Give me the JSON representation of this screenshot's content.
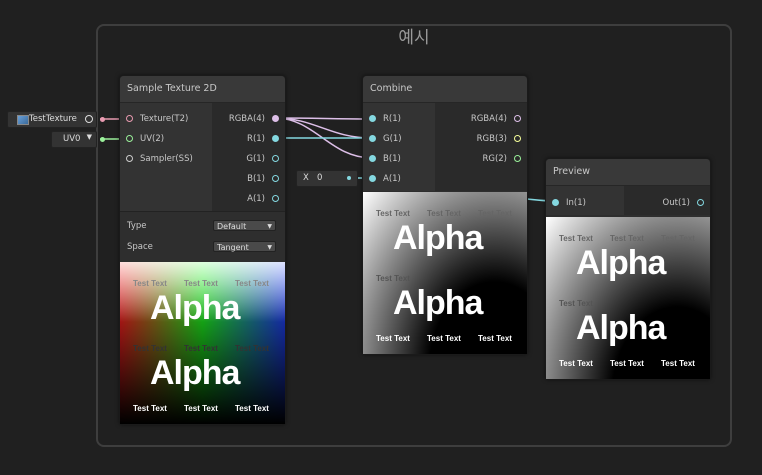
{
  "group": {
    "title": "예시"
  },
  "colors": {
    "background": "#202020",
    "texture_port": "#e89ab0",
    "vector4_port": "#ddbfe8",
    "vector1_port": "#84d8e0",
    "vector3_port": "#f6ff9a",
    "vector2_port": "#9af09a",
    "sampler_port": "#cccccc"
  },
  "sample_texture": {
    "title": "Sample Texture 2D",
    "inputs": [
      {
        "label": "Texture(T2)",
        "icon": "texture-port-icon"
      },
      {
        "label": "UV(2)",
        "icon": "vector2-port-icon"
      },
      {
        "label": "Sampler(SS)",
        "icon": "sampler-port-icon"
      }
    ],
    "outputs": [
      {
        "label": "RGBA(4)"
      },
      {
        "label": "R(1)"
      },
      {
        "label": "G(1)"
      },
      {
        "label": "B(1)"
      },
      {
        "label": "A(1)"
      }
    ],
    "type_label": "Type",
    "type_value": "Default",
    "space_label": "Space",
    "space_value": "Tangent"
  },
  "texture_field": {
    "value": "TestTexture",
    "icon": "texture-asset-icon"
  },
  "uv_field": {
    "value": "UV0"
  },
  "combine": {
    "title": "Combine",
    "inputs": [
      {
        "label": "R(1)"
      },
      {
        "label": "G(1)"
      },
      {
        "label": "B(1)"
      },
      {
        "label": "A(1)"
      }
    ],
    "outputs": [
      {
        "label": "RGBA(4)"
      },
      {
        "label": "RGB(3)"
      },
      {
        "label": "RG(2)"
      }
    ]
  },
  "alpha_field": {
    "axis": "X",
    "value": "0"
  },
  "preview": {
    "title": "Preview",
    "inputs": [
      {
        "label": "In(1)"
      }
    ],
    "outputs": [
      {
        "label": "Out(1)"
      }
    ]
  },
  "preview_texts": {
    "small": "Test Text",
    "big": "Alpha"
  }
}
